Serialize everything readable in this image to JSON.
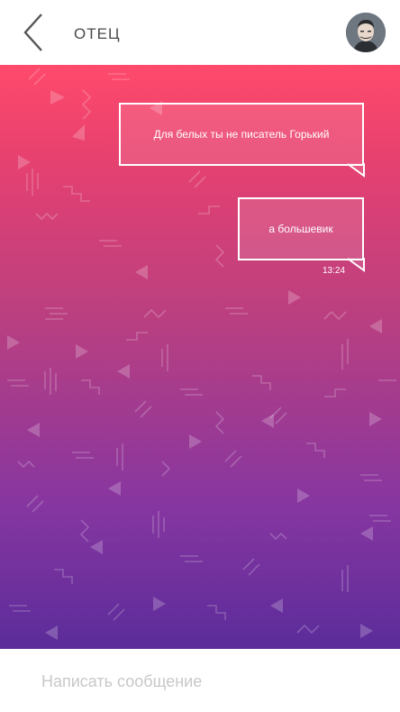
{
  "header": {
    "title": "ОТЕЦ",
    "back_icon": "chevron-left-icon",
    "avatar_icon": "contact-avatar"
  },
  "messages": [
    {
      "text": "Для белых ты не писатель Горький",
      "time": ""
    },
    {
      "text": "а большевик",
      "time": "13:24"
    }
  ],
  "composer": {
    "placeholder": "Написать сообщение",
    "value": ""
  },
  "colors": {
    "gradient_top": "#ff4a6b",
    "gradient_bottom": "#5b2c9a",
    "header_text": "#4a4a4a",
    "placeholder": "#c8c8c8"
  }
}
